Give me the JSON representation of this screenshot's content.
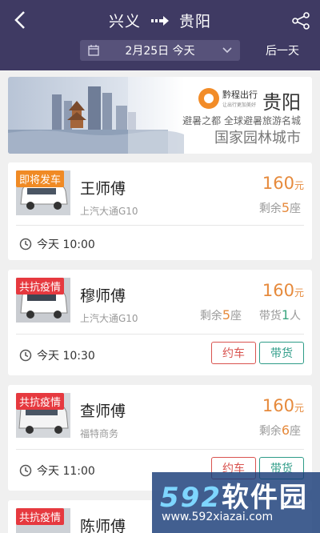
{
  "header": {
    "origin": "兴义",
    "destination": "贵阳",
    "date_label": "2月25日  今天",
    "next_day_label": "后一天",
    "icons": {
      "back": "back-arrow-icon",
      "share": "share-icon",
      "calendar": "calendar-icon",
      "dropdown": "chevron-down-icon"
    }
  },
  "banner": {
    "brand": "黔程出行",
    "brand_sub": "让出行更加美好",
    "city": "贵阳",
    "tagline_1": "避暑之都  全球避暑旅游名城",
    "tagline_2": "国家园林城市"
  },
  "trips": [
    {
      "badge": "即将发车",
      "badge_color": "#f08a24",
      "driver": "王师傅",
      "vehicle": "上汽大通G10",
      "price": "160",
      "currency": "元",
      "seats_prefix": "剩余",
      "seats": "5",
      "seats_suffix": "座",
      "time": "今天 10:00"
    },
    {
      "badge": "共抗疫情",
      "badge_color": "#e6393f",
      "driver": "穆师傅",
      "vehicle": "上汽大通G10",
      "price": "160",
      "currency": "元",
      "seats_prefix": "剩余",
      "seats": "5",
      "seats_suffix": "座",
      "cargo_prefix": "带货",
      "cargo": "1",
      "cargo_suffix": "人",
      "time": "今天 10:30",
      "book_label": "约车",
      "cargo_label": "带货"
    },
    {
      "badge": "共抗疫情",
      "badge_color": "#e6393f",
      "driver": "查师傅",
      "vehicle": "福特商务",
      "price": "160",
      "currency": "元",
      "seats_prefix": "剩余",
      "seats": "6",
      "seats_suffix": "座",
      "time": "今天 11:00",
      "book_label": "约车",
      "cargo_label": "带货"
    },
    {
      "badge": "共抗疫情",
      "badge_color": "#e6393f",
      "driver": "陈师傅"
    }
  ],
  "watermark": {
    "brand_number": "592",
    "brand_text": "软件园",
    "url": "www.592xiazai.com"
  },
  "colors": {
    "header_bg": "#3f3a63",
    "price": "#e68a3c",
    "book": "#d9534f",
    "cargo": "#2e9c88"
  }
}
